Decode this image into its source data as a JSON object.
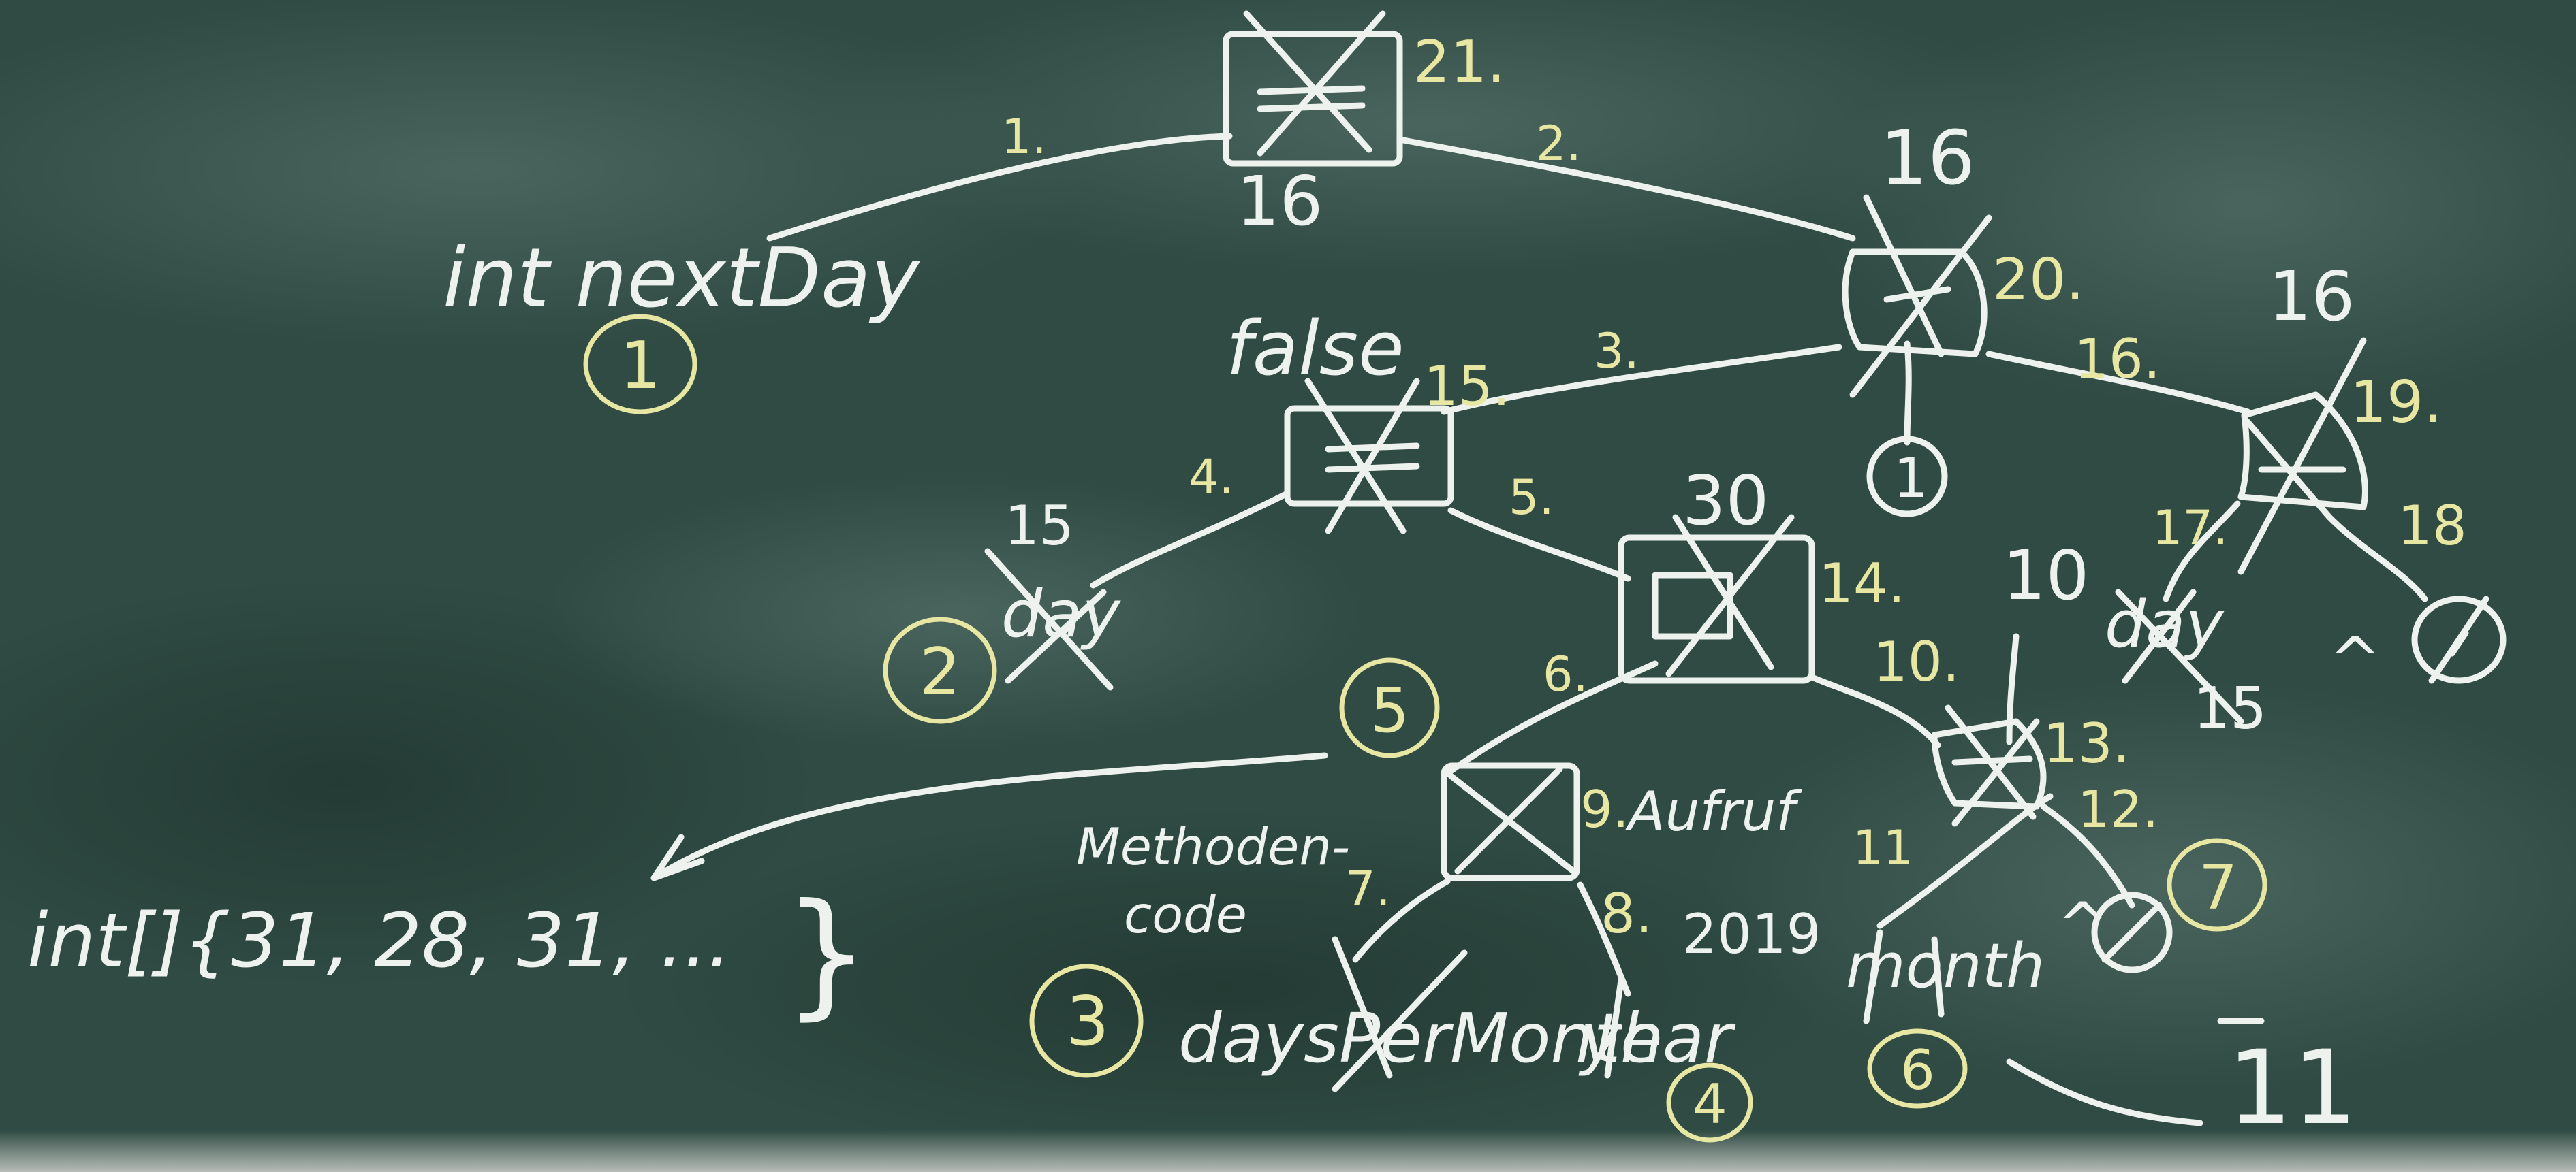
{
  "colors": {
    "board": "#2e4a42",
    "chalk_white": "#eef2ee",
    "chalk_yellow": "#e7e6a2"
  },
  "labels": {
    "root_value_top": "21.",
    "root_value_bottom": "16",
    "edge_1": "1.",
    "edge_2": "2.",
    "int_nextday": "int nextDay",
    "marker_1": "1",
    "node_b_top": "16",
    "node_b_step": "20.",
    "node_b_leaf": "1",
    "edge_3": "3.",
    "edge_16": "16.",
    "node_c_top": "16",
    "node_c_step": "19.",
    "false_label": "false",
    "node_eq_step": "15.",
    "edge_4": "4.",
    "edge_5": "5.",
    "fifteen": "15",
    "day_crossed": "day",
    "marker_2": "2",
    "thirty": "30",
    "node_arr_step": "14.",
    "ten": "10",
    "edge_10": "10.",
    "edge_17": "17.",
    "edge_18": "18",
    "day2_crossed": "day",
    "fifteen_b": "15",
    "caret_1": "^",
    "marker_5": "5",
    "edge_6": "6.",
    "node_call_step": "9.",
    "aufruf": "Aufruf",
    "methoden_1": "Methoden-",
    "methoden_2": "code",
    "edge_7": "7.",
    "edge_8": "8.",
    "year_2019": "2019",
    "node_d_step": "13.",
    "edge_12": "12.",
    "eleven": "11",
    "month_crossed": "month",
    "caret_2": "^",
    "marker_7": "7",
    "int_array": "int[]{31, 28, 31, ...",
    "brace_close": "}",
    "marker_3": "3",
    "days_per_month": "daysPerMonth",
    "year_crossed": "year",
    "marker_4": "4",
    "marker_6": "6",
    "big_11": "11"
  }
}
